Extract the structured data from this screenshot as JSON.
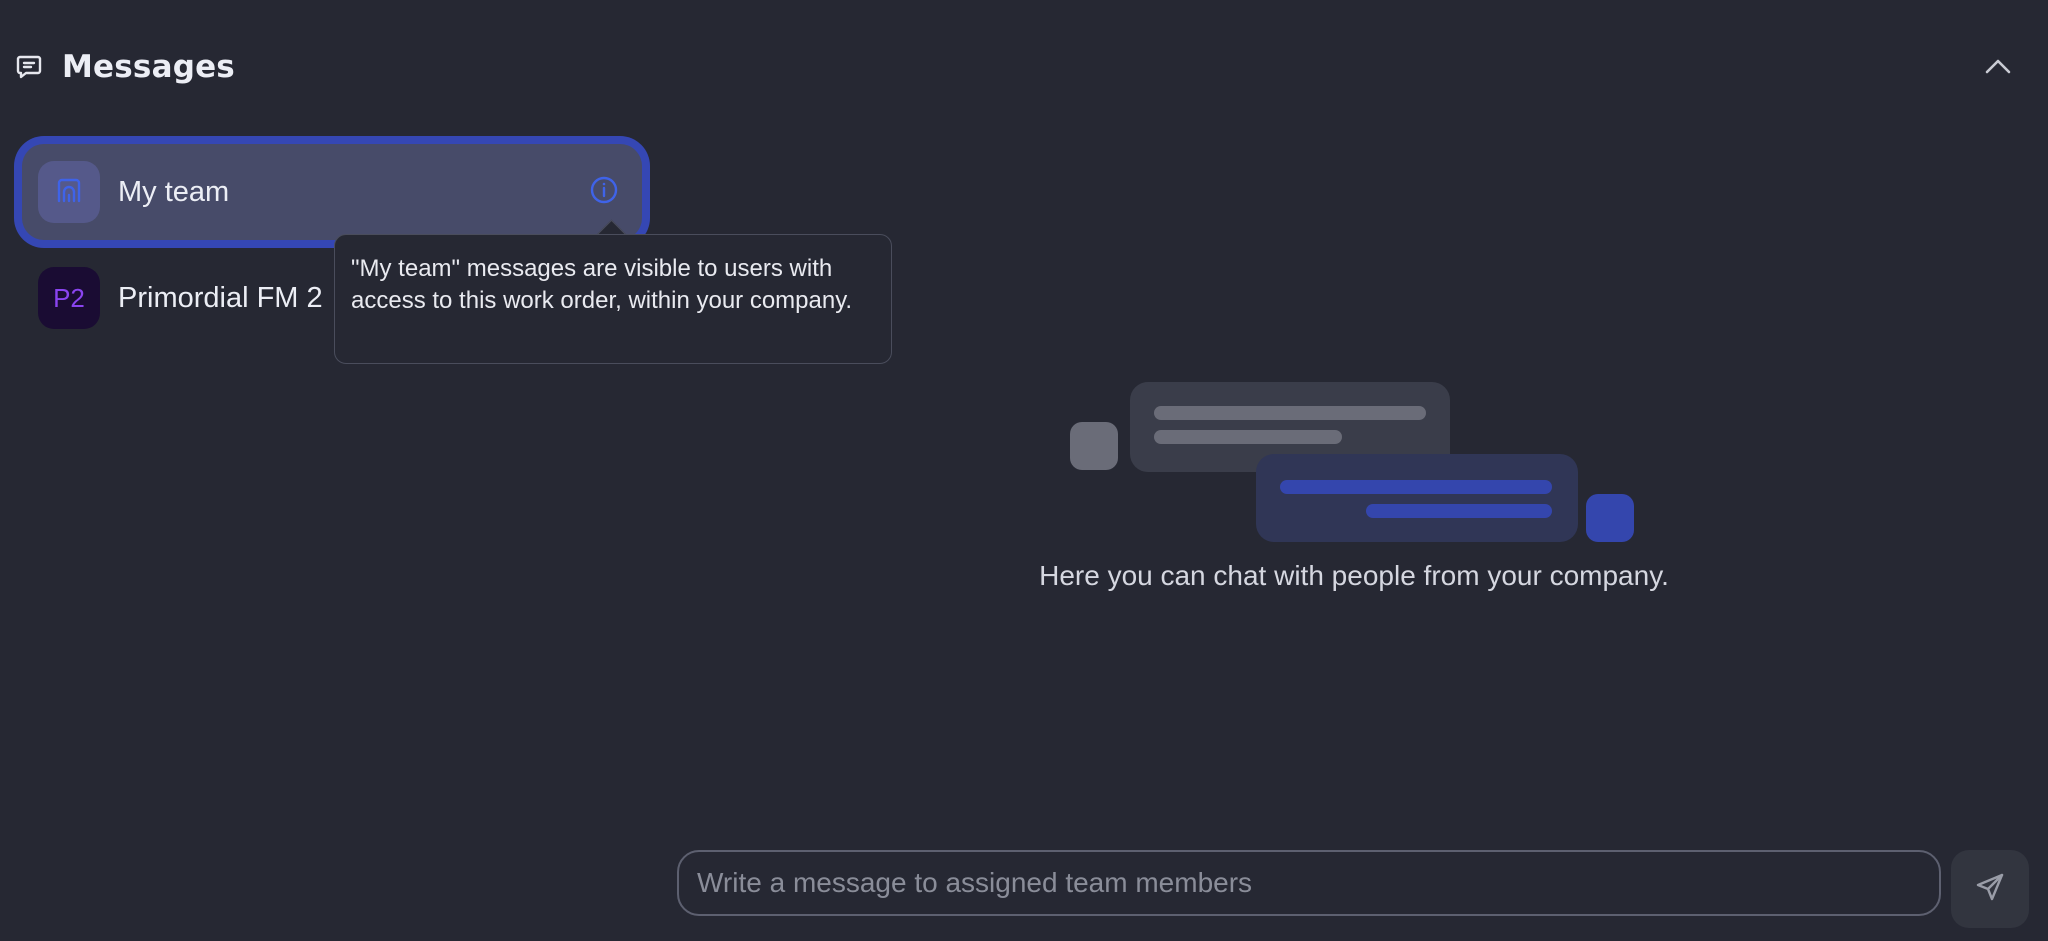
{
  "header": {
    "title": "Messages",
    "icon": "message-square-icon",
    "collapse_icon": "chevron-up-icon"
  },
  "channels": [
    {
      "label": "My team",
      "icon": "team-icon",
      "active": true,
      "info_icon": "info-icon"
    },
    {
      "label": "Primordial FM 2",
      "avatar_text": "P2",
      "active": false
    }
  ],
  "tooltip": {
    "text": "\"My team\" messages are visible to users with access to this work order, within your company."
  },
  "empty_state": {
    "text": "Here you can chat with people from your company."
  },
  "composer": {
    "placeholder": "Write a message to assigned team members",
    "value": "",
    "send_icon": "send-icon"
  },
  "colors": {
    "background": "#262833",
    "accent": "#3547b4",
    "active_item": "#474b69",
    "p2_avatar_text": "#8a44f0"
  }
}
